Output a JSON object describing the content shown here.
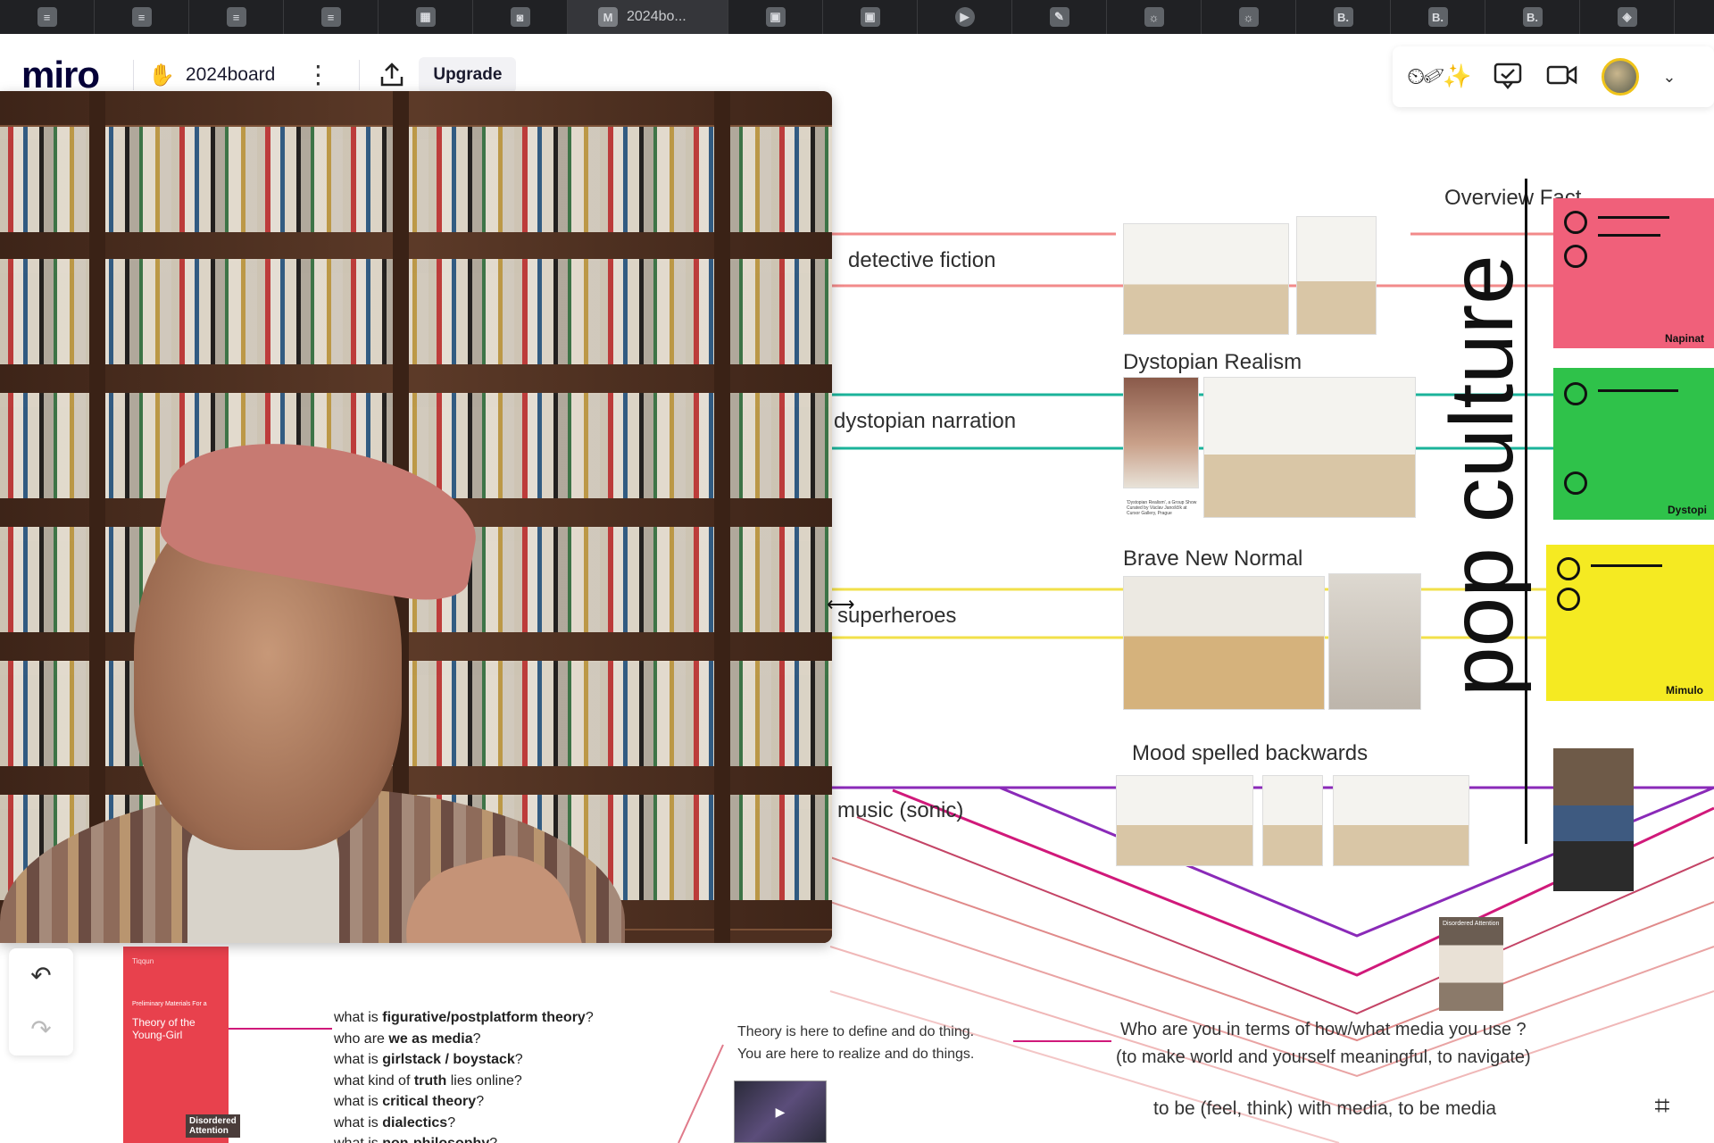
{
  "browser": {
    "tabs": [
      {
        "icon": "document-icon",
        "label": ""
      },
      {
        "icon": "document-icon",
        "label": ""
      },
      {
        "icon": "document-icon",
        "label": ""
      },
      {
        "icon": "document-icon",
        "label": ""
      },
      {
        "icon": "keyboard-icon",
        "label": ""
      },
      {
        "icon": "dark-square-icon",
        "label": ""
      },
      {
        "icon": "miro-icon",
        "label": "2024bo..."
      },
      {
        "icon": "image-icon",
        "label": ""
      },
      {
        "icon": "image-icon",
        "label": ""
      },
      {
        "icon": "play-icon",
        "label": ""
      },
      {
        "icon": "feather-icon",
        "label": ""
      },
      {
        "icon": "sun-icon",
        "label": ""
      },
      {
        "icon": "sun-icon",
        "label": ""
      },
      {
        "icon": "b-icon",
        "label": "B."
      },
      {
        "icon": "b-icon",
        "label": "B."
      },
      {
        "icon": "b-icon",
        "label": "B."
      },
      {
        "icon": "gem-icon",
        "label": ""
      }
    ]
  },
  "miro": {
    "logo": "miro",
    "board_name": "2024board",
    "upgrade_label": "Upgrade"
  },
  "canvas": {
    "rows": [
      {
        "label": "detective fiction",
        "color": "#f28a8a"
      },
      {
        "label": "dystopian narration",
        "color": "#1bb39a"
      },
      {
        "label": "superheroes",
        "color": "#f2e04a"
      },
      {
        "label": "music (sonic)",
        "color": "#8a2ab8"
      }
    ],
    "group_titles": [
      "Dystopian Realism",
      "Brave New Normal",
      "Mood spelled backwards"
    ],
    "overview_label": "Overview Fact",
    "vertical_title": "pop culture",
    "poster_labels": [
      "Napinat",
      "Dystopi",
      "Mimulo"
    ],
    "questions": [
      {
        "prefix": "what is ",
        "bold": "figurative/postplatform theory",
        "suffix": "?"
      },
      {
        "prefix": "who are ",
        "bold": "we as media",
        "suffix": "?"
      },
      {
        "prefix": "what is ",
        "bold": "girlstack / boystack",
        "suffix": "?"
      },
      {
        "prefix": "what kind of ",
        "bold": "truth",
        "suffix": " lies online?"
      },
      {
        "prefix": "what is ",
        "bold": "critical theory",
        "suffix": "?"
      },
      {
        "prefix": "what is ",
        "bold": "dialectics",
        "suffix": "?"
      },
      {
        "prefix": "what is ",
        "bold": "non-philosophy",
        "suffix": "?"
      }
    ],
    "theory_lines": [
      "Theory is here to define and do thing.",
      "You are here to realize and do things."
    ],
    "who_lines": [
      "Who are you in terms of how/what media you use ?",
      "(to make world and yourself meaningful, to navigate)"
    ],
    "feel_line": "to be (feel, think) with media, to be media",
    "red_book": {
      "top": "Tiqqun",
      "subtitle": "Preliminary Materials For a",
      "title": "Theory of the Young-Girl",
      "corner": "Disordered Attention"
    },
    "photo_caption": "'Dystopian Realism', a Group Show Curated by Václav Janoščík at Cursor Gallery, Prague",
    "mini_poster_text": "Disordered Attention"
  },
  "colors": {
    "red": "#f28a8a",
    "teal": "#1bb39a",
    "yellow": "#f2e04a",
    "purple": "#8a2ab8",
    "magenta": "#d0197a",
    "poster_red": "#f0607a",
    "poster_green": "#2fc24a",
    "poster_yellow": "#f5ea22"
  }
}
